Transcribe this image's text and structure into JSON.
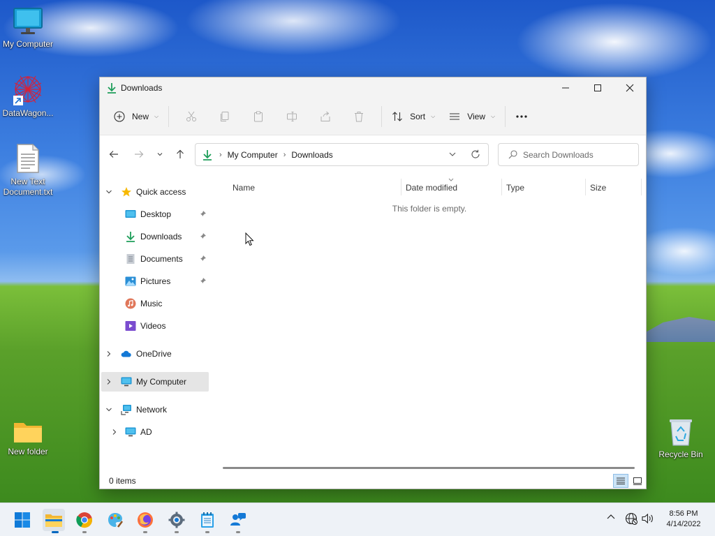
{
  "desktop": {
    "icons": [
      {
        "label": "My Computer"
      },
      {
        "label": "DataWagon..."
      },
      {
        "label": "New Text Document.txt"
      },
      {
        "label": "New folder"
      },
      {
        "label": "Recycle Bin"
      }
    ]
  },
  "window": {
    "title": "Downloads",
    "controls": {
      "minimize": "minimize",
      "maximize": "maximize",
      "close": "close"
    },
    "toolbar": {
      "new_label": "New",
      "sort_label": "Sort",
      "view_label": "View",
      "more_label": "..."
    },
    "address": {
      "crumbs": [
        "My Computer",
        "Downloads"
      ],
      "search_placeholder": "Search Downloads"
    },
    "nav": {
      "quick_access": "Quick access",
      "items": [
        "Desktop",
        "Downloads",
        "Documents",
        "Pictures",
        "Music",
        "Videos"
      ],
      "onedrive": "OneDrive",
      "my_computer": "My Computer",
      "network": "Network",
      "ad": "AD"
    },
    "columns": [
      "Name",
      "Date modified",
      "Type",
      "Size"
    ],
    "empty_message": "This folder is empty.",
    "status": "0 items"
  },
  "taskbar": {
    "time": "8:56 PM",
    "date": "4/14/2022"
  },
  "colors": {
    "accent": "#0067c0",
    "download_green": "#1e9e5a",
    "selected_bg": "#e5e5e5"
  }
}
